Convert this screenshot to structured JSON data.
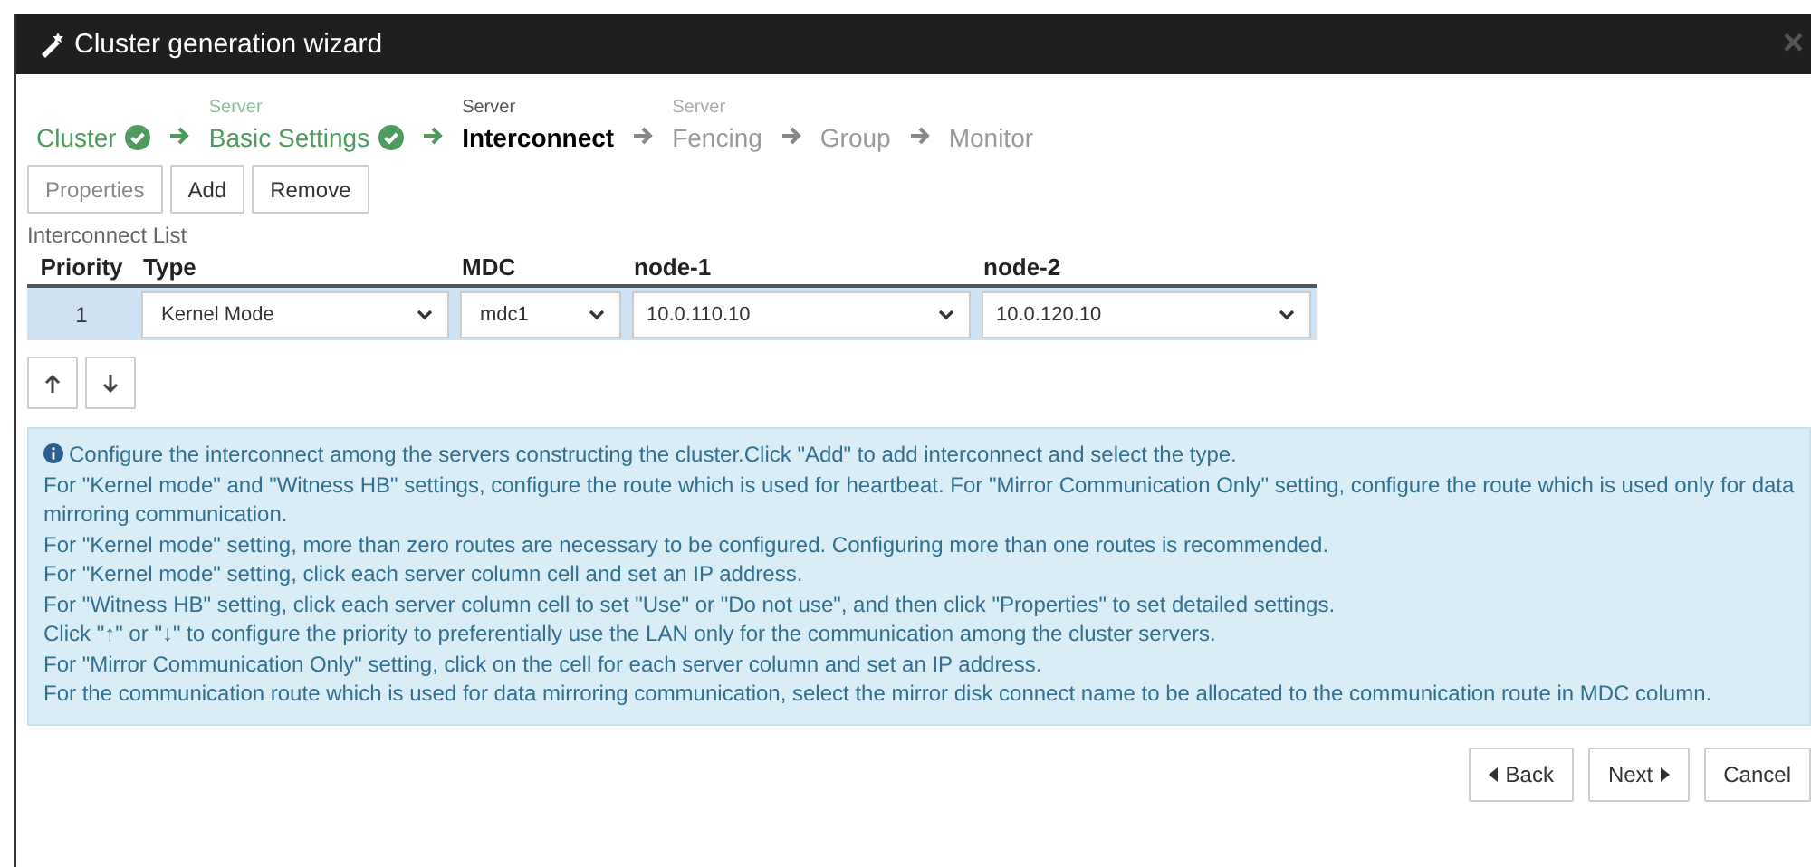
{
  "window": {
    "title": "Cluster generation wizard",
    "close": "×"
  },
  "steps": [
    {
      "label": "Cluster",
      "done": true,
      "selected": false
    },
    {
      "group": "Server",
      "label": "Basic Settings",
      "done": true,
      "selected": false
    },
    {
      "group": "Server",
      "label": "Interconnect",
      "done": false,
      "selected": true
    },
    {
      "group": "Server",
      "label": "Fencing",
      "done": false,
      "selected": false
    },
    {
      "label": "Group",
      "done": false,
      "selected": false
    },
    {
      "label": "Monitor",
      "done": false,
      "selected": false
    }
  ],
  "toolbar": [
    {
      "label": "Properties",
      "disabled": true
    },
    {
      "label": "Add",
      "disabled": false
    },
    {
      "label": "Remove",
      "disabled": false
    }
  ],
  "table": {
    "title": "Interconnect List",
    "columns": [
      "Priority",
      "Type",
      "MDC",
      "node-1",
      "node-2"
    ],
    "rows": [
      {
        "selected": true,
        "cells": [
          "1",
          "Kernel Mode",
          "mdc1",
          "10.0.110.10",
          "10.0.120.10"
        ]
      }
    ]
  },
  "info": {
    "lines": [
      "Configure the interconnect among the servers constructing the cluster.Click \"Add\" to add interconnect and select the type.",
      "For \"Kernel mode\" and \"Witness HB\" settings, configure the route which is used for heartbeat. For \"Mirror Communication Only\" setting, configure the route which is used only for data mirroring communication.",
      "For \"Kernel mode\" setting, more than zero routes are necessary to be configured. Configuring more than one routes is recommended.",
      "For \"Kernel mode\" setting, click each server column cell and set an IP address.",
      "For \"Witness HB\" setting, click each server column cell to set \"Use\" or \"Do not use\", and then click \"Properties\" to set detailed settings.",
      "Click \"↑\" or \"↓\" to configure the priority to preferentially use the LAN only for the communication among the cluster servers.",
      "For \"Mirror Communication Only\" setting, click on the cell for each server column and set an IP address.",
      "For the communication route which is used for data mirroring communication, select the mirror disk connect name to be allocated to the communication route in MDC column."
    ]
  },
  "footer": [
    {
      "kind": "back",
      "label": "Back"
    },
    {
      "kind": "next",
      "label": "Next"
    },
    {
      "kind": "plain",
      "label": "Cancel"
    }
  ]
}
